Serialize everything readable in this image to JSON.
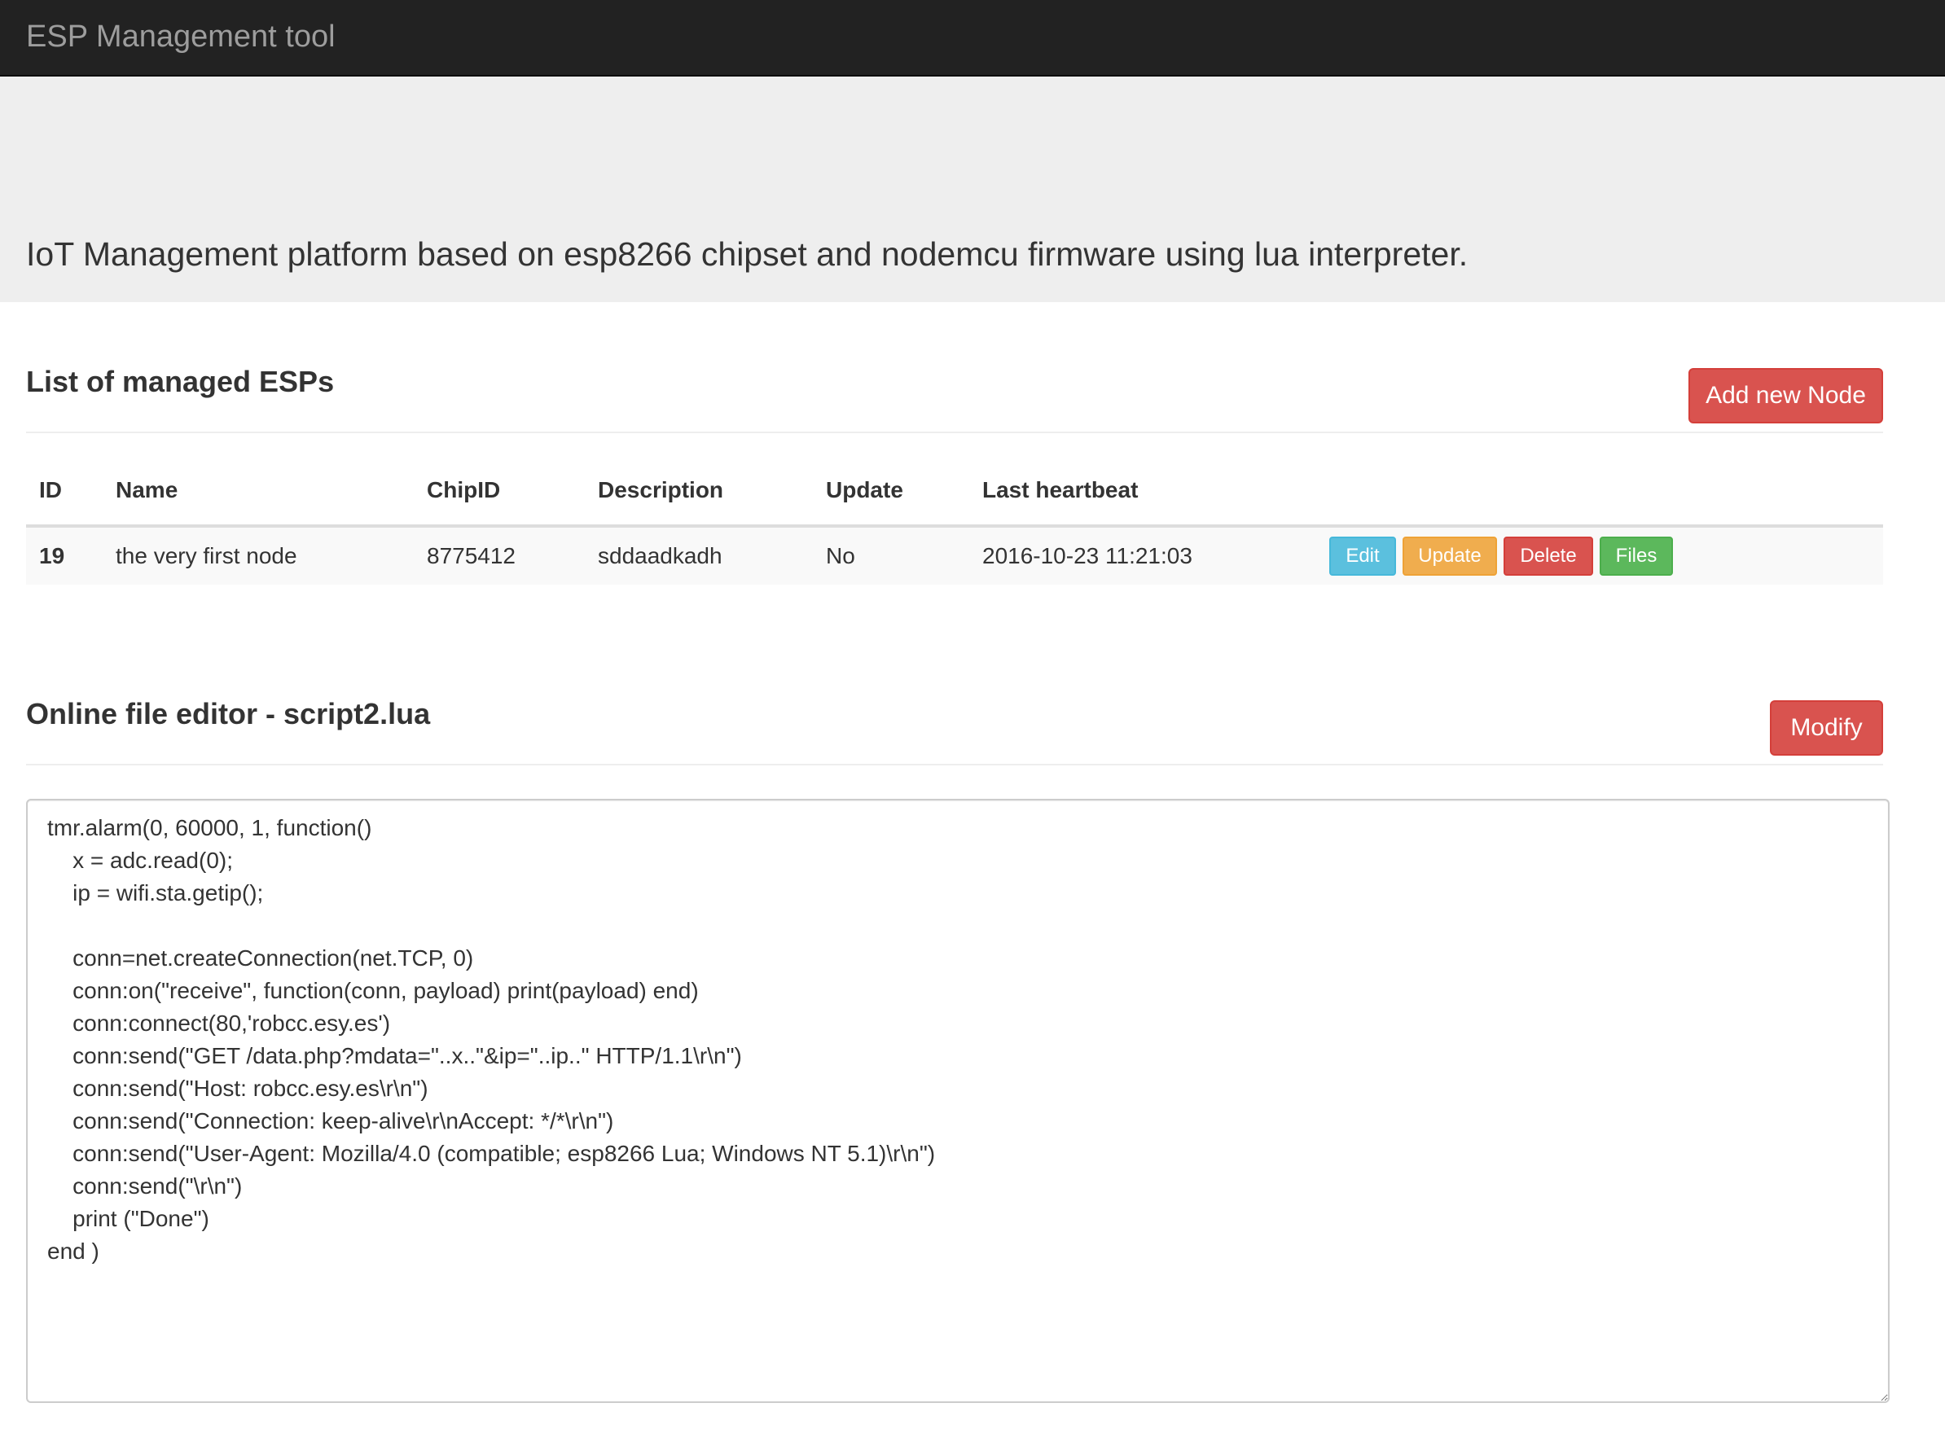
{
  "navbar": {
    "brand": "ESP Management tool"
  },
  "jumbotron": {
    "lead": "IoT Management platform based on esp8266 chipset and nodemcu firmware using lua interpreter."
  },
  "nodes_section": {
    "title": "List of managed ESPs",
    "add_button_label": "Add new Node",
    "table": {
      "headers": [
        "ID",
        "Name",
        "ChipID",
        "Description",
        "Update",
        "Last heartbeat"
      ],
      "rows": [
        {
          "id": "19",
          "name": "the very first node",
          "chipid": "8775412",
          "description": "sddaadkadh",
          "update": "No",
          "last_heartbeat": "2016-10-23 11:21:03",
          "actions": {
            "edit": "Edit",
            "update": "Update",
            "delete": "Delete",
            "files": "Files"
          }
        }
      ]
    }
  },
  "editor_section": {
    "title": "Online file editor - script2.lua",
    "modify_button_label": "Modify",
    "content": "tmr.alarm(0, 60000, 1, function()\n    x = adc.read(0);\n    ip = wifi.sta.getip();\n\n    conn=net.createConnection(net.TCP, 0)\n    conn:on(\"receive\", function(conn, payload) print(payload) end)\n    conn:connect(80,'robcc.esy.es')\n    conn:send(\"GET /data.php?mdata=\"..x..\"&ip=\"..ip..\" HTTP/1.1\\r\\n\")\n    conn:send(\"Host: robcc.esy.es\\r\\n\")\n    conn:send(\"Connection: keep-alive\\r\\nAccept: */*\\r\\n\")\n    conn:send(\"User-Agent: Mozilla/4.0 (compatible; esp8266 Lua; Windows NT 5.1)\\r\\n\")\n    conn:send(\"\\r\\n\")\n    print (\"Done\")\nend )"
  }
}
